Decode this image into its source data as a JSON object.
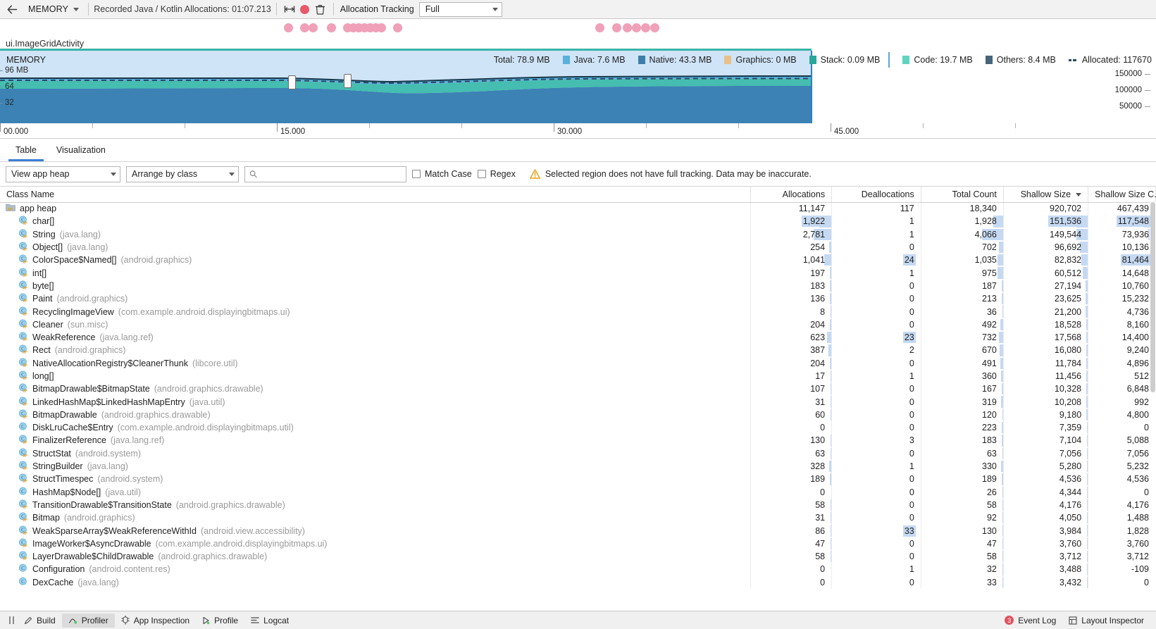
{
  "toolbar": {
    "back_icon": "arrow-left-icon",
    "stage_label": "MEMORY",
    "recording_label": "Recorded Java / Kotlin Allocations: 01:07.213",
    "range_icon": "select-range-icon",
    "record_icon": "record-icon",
    "trash_icon": "trash-icon",
    "tracking_label": "Allocation Tracking",
    "tracking_value": "Full"
  },
  "activity": {
    "label": "ui.ImageGridActivity"
  },
  "graph": {
    "title": "MEMORY",
    "total_label": "Total: 78.9 MB",
    "legend": [
      {
        "name": "java",
        "label": "Java: 7.6 MB",
        "color": "#59b0dd"
      },
      {
        "name": "native",
        "label": "Native: 43.3 MB",
        "color": "#3c7ea8"
      },
      {
        "name": "graphics",
        "label": "Graphics: 0 MB",
        "color": "#e8c08a"
      },
      {
        "name": "stack",
        "label": "Stack: 0.09 MB",
        "color": "#2aa79b"
      },
      {
        "name": "code",
        "label": "Code: 19.7 MB",
        "color": "#5fd5c0"
      },
      {
        "name": "others",
        "label": "Others: 8.4 MB",
        "color": "#47657a"
      },
      {
        "name": "allocated",
        "label": "Allocated: 117670",
        "color": "#2b4a5e"
      }
    ],
    "y_axis_left": [
      "96 MB",
      "64",
      "32"
    ],
    "y_axis_right": [
      "150000",
      "100000",
      "50000"
    ],
    "time_ticks": [
      "00.000",
      "15.000",
      "30.000",
      "45.000"
    ]
  },
  "tabs": [
    {
      "label": "Table",
      "active": true
    },
    {
      "label": "Visualization",
      "active": false
    }
  ],
  "filters": {
    "heap_value": "View app heap",
    "arrange_value": "Arrange by class",
    "search_placeholder": "",
    "search_value": "",
    "search_icon": "search-icon",
    "match_case_label": "Match Case",
    "regex_label": "Regex",
    "warning_icon": "warning-icon",
    "warning_text": "Selected region does not have full tracking. Data may be inaccurate."
  },
  "table": {
    "columns": [
      {
        "label": "Class Name",
        "sorted": false
      },
      {
        "label": "Allocations",
        "sorted": false
      },
      {
        "label": "Deallocations",
        "sorted": false
      },
      {
        "label": "Total Count",
        "sorted": false
      },
      {
        "label": "Shallow Size",
        "sorted": true
      },
      {
        "label": "Shallow Size C...",
        "sorted": false
      }
    ],
    "rows": [
      {
        "icon": "heap-icon",
        "indent": 0,
        "name": "app heap",
        "pkg": "",
        "allocations": "11,147",
        "deallocations": "117",
        "total": "18,340",
        "shallow": "920,702",
        "shallowc": "467,439",
        "bars": [
          0,
          0,
          0,
          0,
          0
        ],
        "hl": []
      },
      {
        "icon": "class-icon",
        "indent": 1,
        "name": "char[]",
        "pkg": "",
        "allocations": "1,922",
        "deallocations": "1",
        "total": "1,928",
        "shallow": "151,536",
        "shallowc": "117,548",
        "bars": [
          17,
          0,
          14,
          16,
          16
        ],
        "hl": [
          0,
          3,
          4
        ]
      },
      {
        "icon": "class-icon",
        "indent": 1,
        "name": "String",
        "pkg": "(java.lang)",
        "allocations": "2,781",
        "deallocations": "1",
        "total": "4,066",
        "shallow": "149,544",
        "shallowc": "73,936",
        "bars": [
          25,
          0,
          30,
          16,
          10
        ],
        "hl": []
      },
      {
        "icon": "class-icon",
        "indent": 1,
        "name": "Object[]",
        "pkg": "(java.lang)",
        "allocations": "254",
        "deallocations": "0",
        "total": "702",
        "shallow": "96,692",
        "shallowc": "10,136",
        "bars": [
          3,
          0,
          6,
          11,
          2
        ],
        "hl": []
      },
      {
        "icon": "class-icon",
        "indent": 1,
        "name": "ColorSpace$Named[]",
        "pkg": "(android.graphics)",
        "allocations": "1,041",
        "deallocations": "24",
        "total": "1,035",
        "shallow": "82,832",
        "shallowc": "81,464",
        "bars": [
          10,
          0,
          8,
          9,
          11
        ],
        "hl": [
          1,
          4
        ]
      },
      {
        "icon": "class-icon",
        "indent": 1,
        "name": "int[]",
        "pkg": "",
        "allocations": "197",
        "deallocations": "1",
        "total": "975",
        "shallow": "60,512",
        "shallowc": "14,648",
        "bars": [
          2,
          0,
          8,
          7,
          2
        ],
        "hl": []
      },
      {
        "icon": "class-icon",
        "indent": 1,
        "name": "byte[]",
        "pkg": "",
        "allocations": "183",
        "deallocations": "0",
        "total": "187",
        "shallow": "27,194",
        "shallowc": "10,760",
        "bars": [
          2,
          0,
          2,
          3,
          2
        ],
        "hl": []
      },
      {
        "icon": "class-icon",
        "indent": 1,
        "name": "Paint",
        "pkg": "(android.graphics)",
        "allocations": "136",
        "deallocations": "0",
        "total": "213",
        "shallow": "23,625",
        "shallowc": "15,232",
        "bars": [
          2,
          0,
          2,
          3,
          2
        ],
        "hl": []
      },
      {
        "icon": "class-icon",
        "indent": 1,
        "name": "RecyclingImageView",
        "pkg": "(com.example.android.displayingbitmaps.ui)",
        "allocations": "8",
        "deallocations": "0",
        "total": "36",
        "shallow": "21,200",
        "shallowc": "4,736",
        "bars": [
          1,
          0,
          1,
          3,
          1
        ],
        "hl": []
      },
      {
        "icon": "class-icon",
        "indent": 1,
        "name": "Cleaner",
        "pkg": "(sun.misc)",
        "allocations": "204",
        "deallocations": "0",
        "total": "492",
        "shallow": "18,528",
        "shallowc": "8,160",
        "bars": [
          2,
          0,
          4,
          2,
          1
        ],
        "hl": []
      },
      {
        "icon": "class-icon",
        "indent": 1,
        "name": "WeakReference",
        "pkg": "(java.lang.ref)",
        "allocations": "623",
        "deallocations": "23",
        "total": "732",
        "shallow": "17,568",
        "shallowc": "14,400",
        "bars": [
          6,
          0,
          6,
          2,
          2
        ],
        "hl": [
          1
        ]
      },
      {
        "icon": "class-icon",
        "indent": 1,
        "name": "Rect",
        "pkg": "(android.graphics)",
        "allocations": "387",
        "deallocations": "2",
        "total": "670",
        "shallow": "16,080",
        "shallowc": "9,240",
        "bars": [
          4,
          0,
          5,
          2,
          1
        ],
        "hl": []
      },
      {
        "icon": "class-icon",
        "indent": 1,
        "name": "NativeAllocationRegistry$CleanerThunk",
        "pkg": "(libcore.util)",
        "allocations": "204",
        "deallocations": "0",
        "total": "491",
        "shallow": "11,784",
        "shallowc": "4,896",
        "bars": [
          2,
          0,
          4,
          2,
          1
        ],
        "hl": []
      },
      {
        "icon": "class-icon",
        "indent": 1,
        "name": "long[]",
        "pkg": "",
        "allocations": "17",
        "deallocations": "1",
        "total": "360",
        "shallow": "11,456",
        "shallowc": "512",
        "bars": [
          1,
          0,
          3,
          2,
          0
        ],
        "hl": []
      },
      {
        "icon": "class-icon",
        "indent": 1,
        "name": "BitmapDrawable$BitmapState",
        "pkg": "(android.graphics.drawable)",
        "allocations": "107",
        "deallocations": "0",
        "total": "167",
        "shallow": "10,328",
        "shallowc": "6,848",
        "bars": [
          1,
          0,
          2,
          2,
          1
        ],
        "hl": []
      },
      {
        "icon": "class-icon",
        "indent": 1,
        "name": "LinkedHashMap$LinkedHashMapEntry",
        "pkg": "(java.util)",
        "allocations": "31",
        "deallocations": "0",
        "total": "319",
        "shallow": "10,208",
        "shallowc": "992",
        "bars": [
          1,
          0,
          3,
          2,
          0
        ],
        "hl": []
      },
      {
        "icon": "class-icon",
        "indent": 1,
        "name": "BitmapDrawable",
        "pkg": "(android.graphics.drawable)",
        "allocations": "60",
        "deallocations": "0",
        "total": "120",
        "shallow": "9,180",
        "shallowc": "4,800",
        "bars": [
          1,
          0,
          1,
          2,
          1
        ],
        "hl": []
      },
      {
        "icon": "class-plain-icon",
        "indent": 1,
        "name": "DiskLruCache$Entry",
        "pkg": "(com.example.android.displayingbitmaps.util)",
        "allocations": "0",
        "deallocations": "0",
        "total": "223",
        "shallow": "7,359",
        "shallowc": "0",
        "bars": [
          0,
          0,
          2,
          1,
          0
        ],
        "hl": []
      },
      {
        "icon": "class-icon",
        "indent": 1,
        "name": "FinalizerReference",
        "pkg": "(java.lang.ref)",
        "allocations": "130",
        "deallocations": "3",
        "total": "183",
        "shallow": "7,104",
        "shallowc": "5,088",
        "bars": [
          1,
          0,
          2,
          1,
          1
        ],
        "hl": []
      },
      {
        "icon": "class-icon",
        "indent": 1,
        "name": "StructStat",
        "pkg": "(android.system)",
        "allocations": "63",
        "deallocations": "0",
        "total": "63",
        "shallow": "7,056",
        "shallowc": "7,056",
        "bars": [
          1,
          0,
          1,
          1,
          1
        ],
        "hl": []
      },
      {
        "icon": "class-icon",
        "indent": 1,
        "name": "StringBuilder",
        "pkg": "(java.lang)",
        "allocations": "328",
        "deallocations": "1",
        "total": "330",
        "shallow": "5,280",
        "shallowc": "5,232",
        "bars": [
          3,
          0,
          3,
          1,
          1
        ],
        "hl": []
      },
      {
        "icon": "class-icon",
        "indent": 1,
        "name": "StructTimespec",
        "pkg": "(android.system)",
        "allocations": "189",
        "deallocations": "0",
        "total": "189",
        "shallow": "4,536",
        "shallowc": "4,536",
        "bars": [
          2,
          0,
          2,
          1,
          1
        ],
        "hl": []
      },
      {
        "icon": "class-plain-icon",
        "indent": 1,
        "name": "HashMap$Node[]",
        "pkg": "(java.util)",
        "allocations": "0",
        "deallocations": "0",
        "total": "26",
        "shallow": "4,344",
        "shallowc": "0",
        "bars": [
          0,
          0,
          1,
          1,
          0
        ],
        "hl": []
      },
      {
        "icon": "class-icon",
        "indent": 1,
        "name": "TransitionDrawable$TransitionState",
        "pkg": "(android.graphics.drawable)",
        "allocations": "58",
        "deallocations": "0",
        "total": "58",
        "shallow": "4,176",
        "shallowc": "4,176",
        "bars": [
          1,
          0,
          1,
          1,
          1
        ],
        "hl": []
      },
      {
        "icon": "class-icon",
        "indent": 1,
        "name": "Bitmap",
        "pkg": "(android.graphics)",
        "allocations": "31",
        "deallocations": "0",
        "total": "92",
        "shallow": "4,050",
        "shallowc": "1,488",
        "bars": [
          1,
          0,
          1,
          1,
          1
        ],
        "hl": []
      },
      {
        "icon": "class-icon",
        "indent": 1,
        "name": "WeakSparseArray$WeakReferenceWithId",
        "pkg": "(android.view.accessibility)",
        "allocations": "86",
        "deallocations": "33",
        "total": "130",
        "shallow": "3,984",
        "shallowc": "1,828",
        "bars": [
          1,
          0,
          1,
          1,
          1
        ],
        "hl": [
          1
        ]
      },
      {
        "icon": "class-icon",
        "indent": 1,
        "name": "ImageWorker$AsyncDrawable",
        "pkg": "(com.example.android.displayingbitmaps.ui)",
        "allocations": "47",
        "deallocations": "0",
        "total": "47",
        "shallow": "3,760",
        "shallowc": "3,760",
        "bars": [
          1,
          0,
          1,
          1,
          1
        ],
        "hl": []
      },
      {
        "icon": "class-icon",
        "indent": 1,
        "name": "LayerDrawable$ChildDrawable",
        "pkg": "(android.graphics.drawable)",
        "allocations": "58",
        "deallocations": "0",
        "total": "58",
        "shallow": "3,712",
        "shallowc": "3,712",
        "bars": [
          1,
          0,
          1,
          1,
          1
        ],
        "hl": []
      },
      {
        "icon": "class-plain-icon",
        "indent": 1,
        "name": "Configuration",
        "pkg": "(android.content.res)",
        "allocations": "0",
        "deallocations": "1",
        "total": "32",
        "shallow": "3,488",
        "shallowc": "-109",
        "bars": [
          0,
          0,
          1,
          1,
          0
        ],
        "hl": []
      },
      {
        "icon": "class-plain-icon",
        "indent": 1,
        "name": "DexCache",
        "pkg": "(java.lang)",
        "allocations": "0",
        "deallocations": "0",
        "total": "33",
        "shallow": "3,432",
        "shallowc": "0",
        "bars": [
          0,
          0,
          1,
          1,
          0
        ],
        "hl": []
      }
    ]
  },
  "statusbar": {
    "left_items": [
      {
        "label": "Build",
        "icon": "build-icon",
        "active": false
      },
      {
        "label": "Profiler",
        "icon": "profiler-icon",
        "active": true
      },
      {
        "label": "App Inspection",
        "icon": "inspection-icon",
        "active": false
      },
      {
        "label": "Profile",
        "icon": "profile-run-icon",
        "active": false
      },
      {
        "label": "Logcat",
        "icon": "logcat-icon",
        "active": false
      }
    ],
    "right_items": [
      {
        "label": "Event Log",
        "icon": "event-log-icon",
        "badge": "3"
      },
      {
        "label": "Layout Inspector",
        "icon": "layout-inspector-icon",
        "badge": ""
      }
    ]
  }
}
